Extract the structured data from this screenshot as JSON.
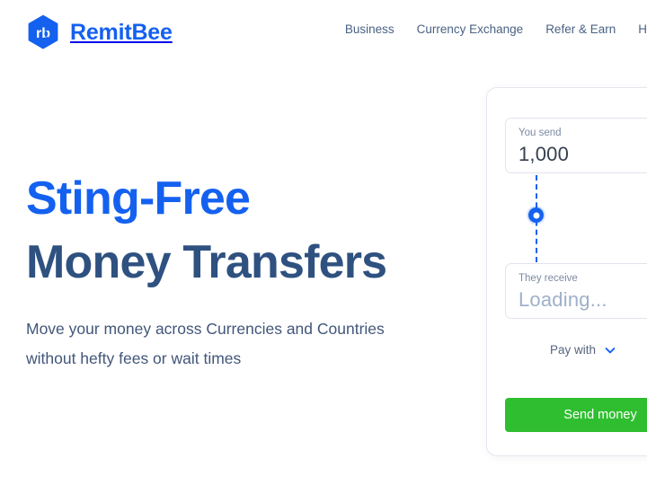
{
  "brand": {
    "name": "RemitBee",
    "mark_letters": "rb",
    "logo_color": "#1461F0"
  },
  "nav": {
    "items": [
      {
        "label": "Business"
      },
      {
        "label": "Currency Exchange"
      },
      {
        "label": "Refer & Earn"
      },
      {
        "label": "Help"
      }
    ]
  },
  "hero": {
    "headline_line1": "Sting-Free",
    "headline_line2": "Money Transfers",
    "headline_line1_color": "#1461F0",
    "headline_line2_color": "#2E5180",
    "subtext": "Move your money across Currencies and Countries without hefty fees or wait times"
  },
  "calculator": {
    "send": {
      "label": "You send",
      "value": "1,000"
    },
    "receive": {
      "label": "They receive",
      "value": "Loading..."
    },
    "pay_with": {
      "label": "Pay with",
      "icon": "chevron-down-icon"
    },
    "submit": {
      "label": "Send money",
      "color": "#2FBE30"
    }
  }
}
